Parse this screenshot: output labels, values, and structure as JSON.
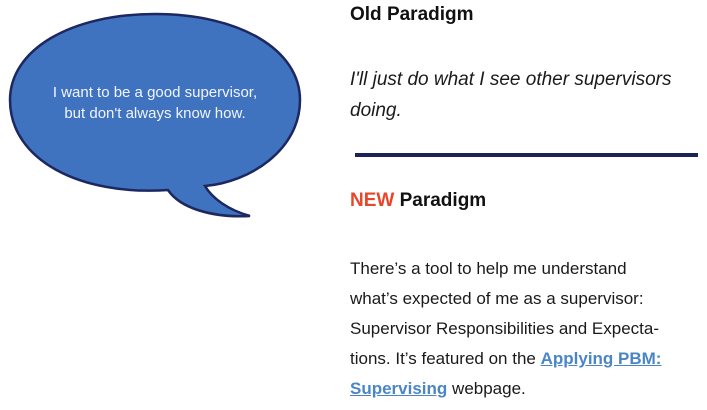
{
  "bubble": {
    "line1": "I want to be a good supervisor,",
    "line2": "but don't always know how.",
    "fill_color": "#3f73c0",
    "stroke_color": "#1d2760"
  },
  "old_paradigm": {
    "title": "Old Paradigm",
    "text_line1": "I'll just do what I see other supervisors",
    "text_line2": "doing."
  },
  "divider_color": "#1d2357",
  "new_paradigm": {
    "new_word": "NEW",
    "title_rest": " Paradigm",
    "accent_color": "#e8462a",
    "line1": "There’s a tool to help me understand",
    "line2": "what’s expected of me as a supervisor:",
    "line3": "Supervisor Responsibilities and Expecta-",
    "line4_pre": "tions. It’s featured on the ",
    "link_part1": "Applying PBM:",
    "link_part2": "Supervising",
    "line5_post": " webpage.",
    "link_color": "#4a86c5"
  }
}
